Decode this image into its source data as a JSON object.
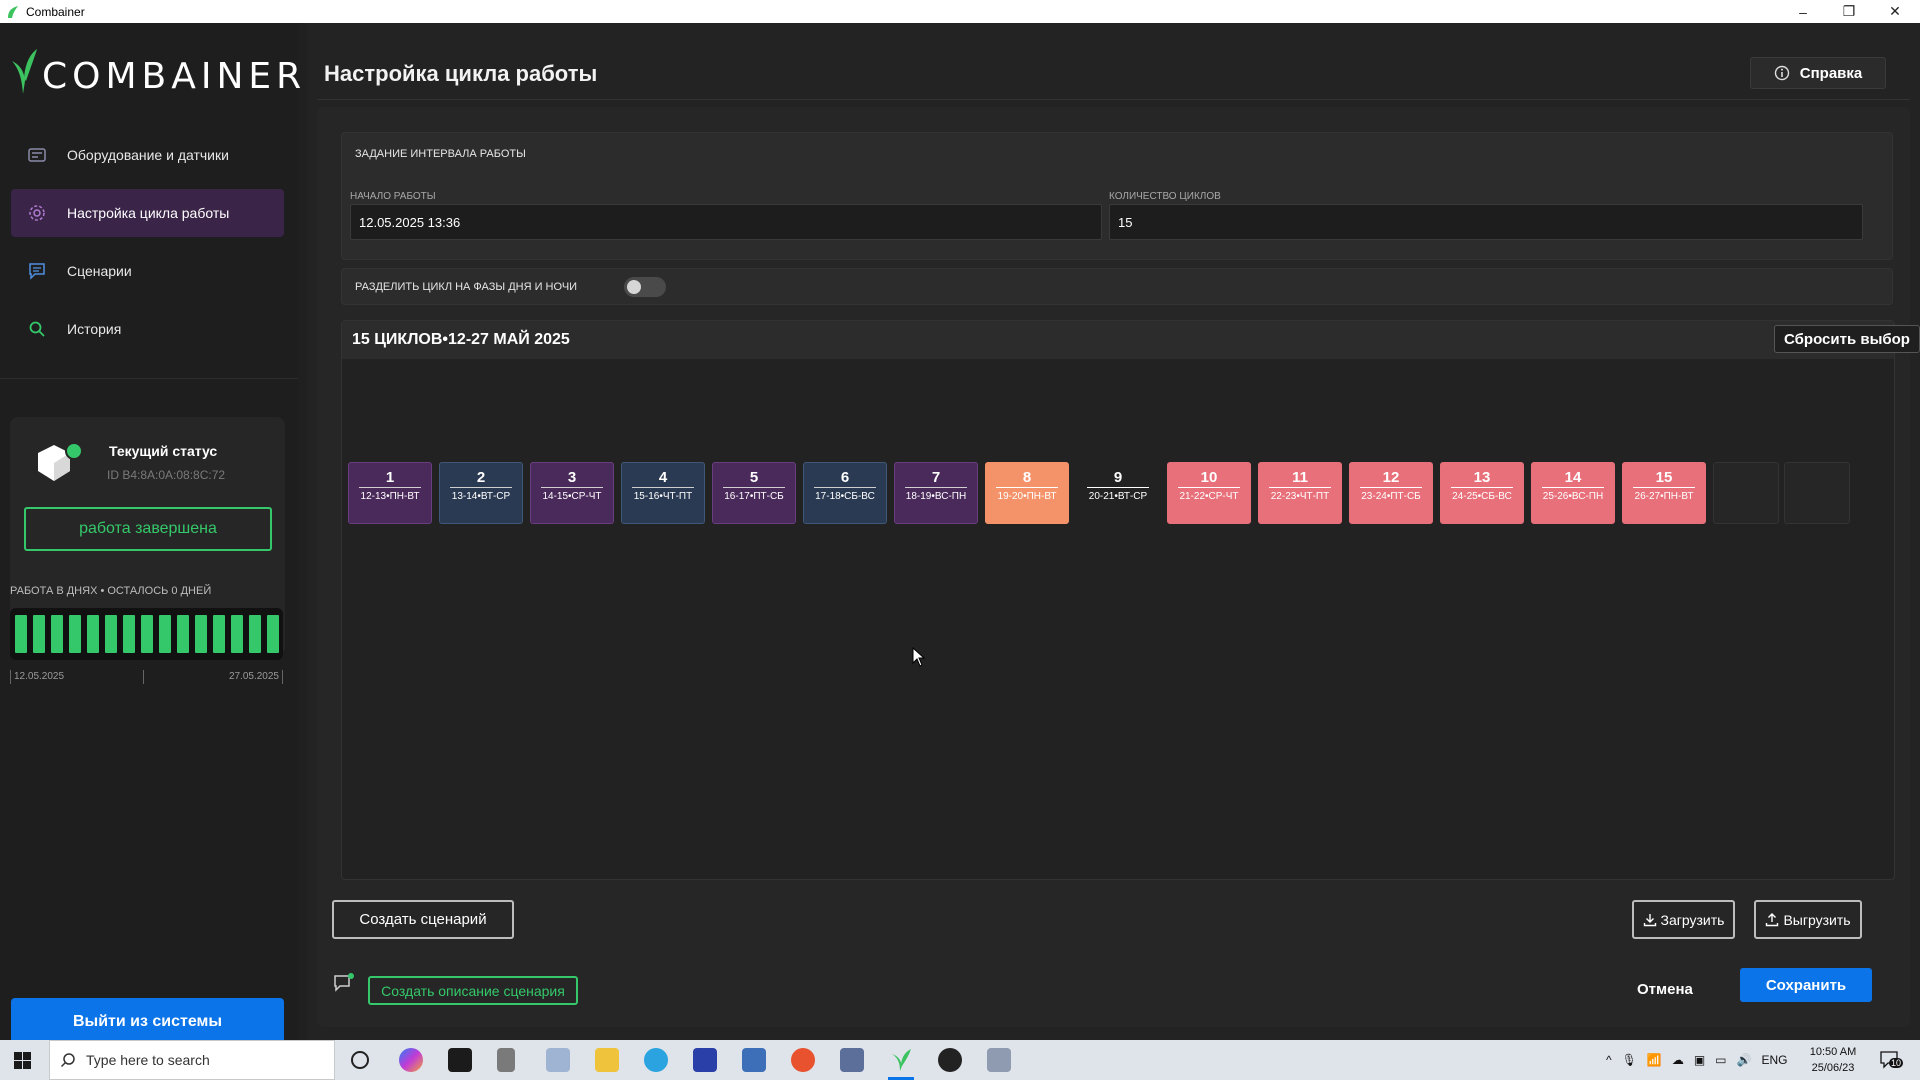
{
  "window": {
    "title": "Combainer"
  },
  "sidebar": {
    "logo_text": "COMBAINER",
    "items": [
      {
        "label": "Оборудование и датчики",
        "icon": "equipment-icon"
      },
      {
        "label": "Настройка цикла работы",
        "icon": "gear-icon",
        "active": true
      },
      {
        "label": "Сценарии",
        "icon": "chat-icon"
      },
      {
        "label": "История",
        "icon": "search-icon"
      }
    ],
    "status": {
      "title": "Текущий статус",
      "id": "ID B4:8A:0A:08:8C:72",
      "state": "работа завершена"
    },
    "days": {
      "caption": "РАБОТА В ДНЯХ • ОСТАЛОСЬ 0 ДНЕЙ",
      "filled": 15,
      "start": "12.05.2025",
      "end": "27.05.2025"
    },
    "logout": "Выйти из системы"
  },
  "main": {
    "title": "Настройка цикла работы",
    "help": "Справка",
    "interval": {
      "title": "ЗАДАНИЕ ИНТЕРВАЛА РАБОТЫ",
      "start_label": "НАЧАЛО РАБОТЫ",
      "start_value": "12.05.2025  13:36",
      "cycles_label": "КОЛИЧЕСТВО ЦИКЛОВ",
      "cycles_value": "15"
    },
    "split": {
      "label": "РАЗДЕЛИТЬ ЦИКЛ НА ФАЗЫ ДНЯ И НОЧИ",
      "on": false
    },
    "cycles": {
      "title": "15 ЦИКЛОВ•12-27 МАЙ 2025",
      "reset": "Сбросить выбор",
      "items": [
        {
          "n": "1",
          "dates": "12-13•ПН-ВТ",
          "style": "purple"
        },
        {
          "n": "2",
          "dates": "13-14•ВТ-СР",
          "style": "blue"
        },
        {
          "n": "3",
          "dates": "14-15•СР-ЧТ",
          "style": "purple"
        },
        {
          "n": "4",
          "dates": "15-16•ЧТ-ПТ",
          "style": "blue"
        },
        {
          "n": "5",
          "dates": "16-17•ПТ-СБ",
          "style": "purple"
        },
        {
          "n": "6",
          "dates": "17-18•СБ-ВС",
          "style": "blue"
        },
        {
          "n": "7",
          "dates": "18-19•ВС-ПН",
          "style": "purple"
        },
        {
          "n": "8",
          "dates": "19-20•ПН-ВТ",
          "style": "orange"
        },
        {
          "n": "9",
          "dates": "20-21•ВТ-СР",
          "style": "dark"
        },
        {
          "n": "10",
          "dates": "21-22•СР-ЧТ",
          "style": "red"
        },
        {
          "n": "11",
          "dates": "22-23•ЧТ-ПТ",
          "style": "red"
        },
        {
          "n": "12",
          "dates": "23-24•ПТ-СБ",
          "style": "red"
        },
        {
          "n": "13",
          "dates": "24-25•СБ-ВС",
          "style": "red"
        },
        {
          "n": "14",
          "dates": "25-26•ВС-ПН",
          "style": "red"
        },
        {
          "n": "15",
          "dates": "26-27•ПН-ВТ",
          "style": "red"
        }
      ],
      "empty_slots": 2
    },
    "create_scenario": "Создать сценарий",
    "load": "Загрузить",
    "unload": "Выгрузить",
    "create_description": "Создать описание сценария",
    "cancel": "Отмена",
    "save": "Сохранить"
  },
  "taskbar": {
    "search_placeholder": "Type here to search",
    "lang": "ENG",
    "time": "10:50 AM",
    "date": "25/06/23",
    "notifications": "10"
  },
  "colors": {
    "accent_green": "#35c86a",
    "primary_blue": "#0b74e8",
    "tile_purple": "#4a2a5a",
    "tile_blue": "#2a3a52",
    "tile_orange": "#f4936a",
    "tile_red": "#e8707a"
  }
}
